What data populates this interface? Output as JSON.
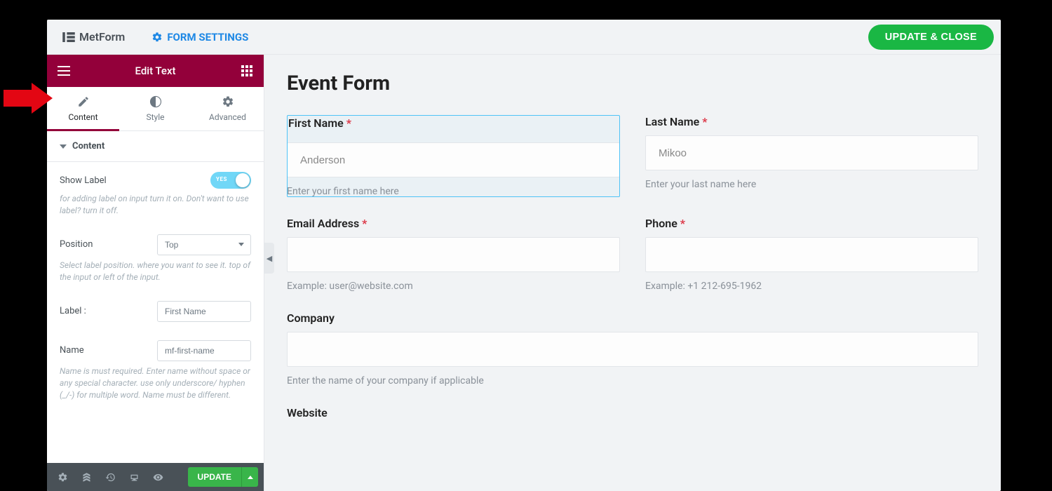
{
  "header": {
    "app_name": "MetForm",
    "form_settings": "FORM SETTINGS",
    "update_close": "UPDATE & CLOSE"
  },
  "sidebar": {
    "title": "Edit Text",
    "tabs": {
      "content": "Content",
      "style": "Style",
      "advanced": "Advanced"
    },
    "section_title": "Content",
    "show_label": {
      "label": "Show Label",
      "state": "YES",
      "help": "for adding label on input turn it on. Don't want to use label? turn it off."
    },
    "position": {
      "label": "Position",
      "value": "Top",
      "help": "Select label position. where you want to see it. top of the input or left of the input."
    },
    "label_field": {
      "label": "Label :",
      "value": "First Name"
    },
    "name_field": {
      "label": "Name",
      "value": "mf-first-name",
      "help": "Name is must required. Enter name without space or any special character. use only underscore/ hyphen (_/-) for multiple word. Name must be different."
    },
    "footer": {
      "update": "UPDATE"
    }
  },
  "form": {
    "title": "Event Form",
    "fields": {
      "first_name": {
        "label": "First Name",
        "placeholder": "Anderson",
        "help": "Enter your first name here"
      },
      "last_name": {
        "label": "Last Name",
        "placeholder": "Mikoo",
        "help": "Enter your last name here"
      },
      "email": {
        "label": "Email Address",
        "help": "Example: user@website.com"
      },
      "phone": {
        "label": "Phone",
        "help": "Example: +1 212-695-1962"
      },
      "company": {
        "label": "Company",
        "help": "Enter the name of your company if applicable"
      },
      "website": {
        "label": "Website"
      }
    }
  }
}
